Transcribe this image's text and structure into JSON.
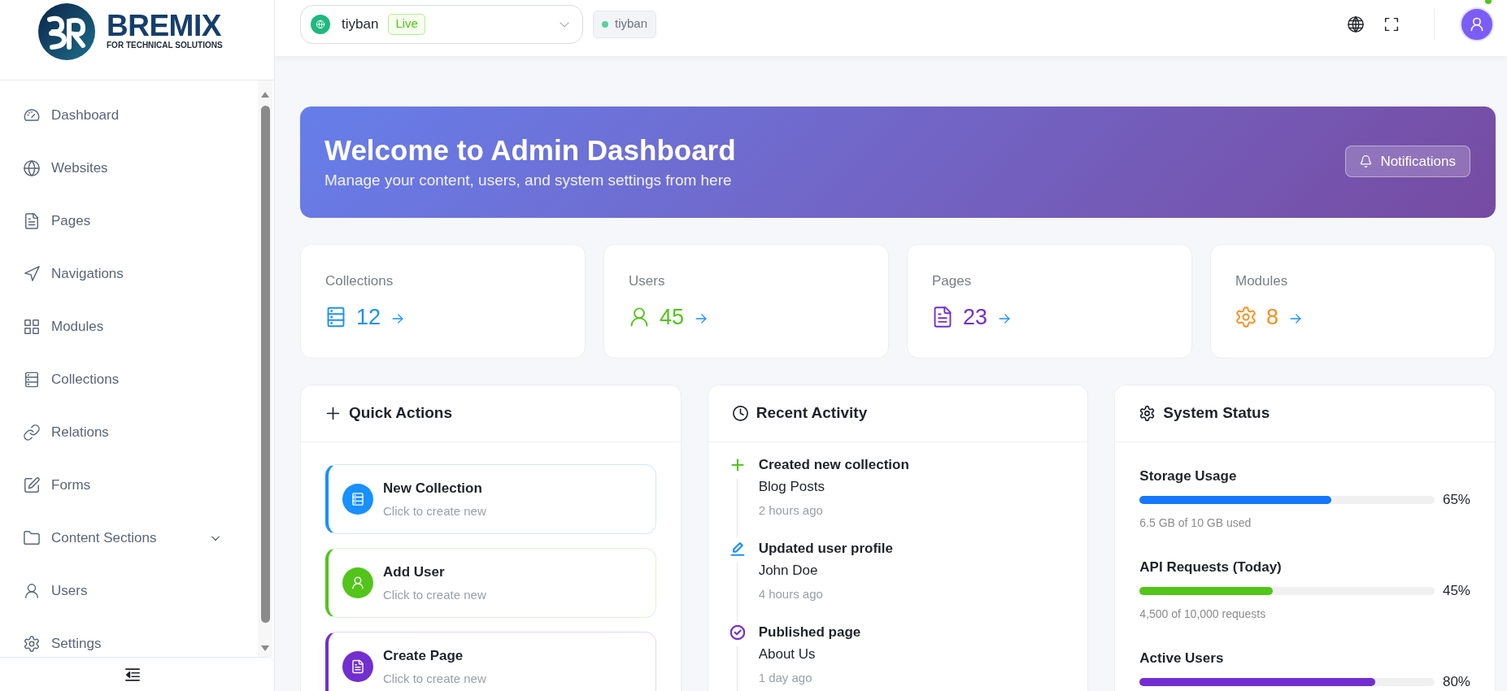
{
  "logo": {
    "name": "BREMIX",
    "tagline": "FOR TECHNICAL SOLUTIONS"
  },
  "sidebar": {
    "items": [
      {
        "kind": "link",
        "label": "Dashboard"
      },
      {
        "kind": "link",
        "label": "Websites"
      },
      {
        "kind": "link",
        "label": "Pages"
      },
      {
        "kind": "link",
        "label": "Navigations"
      },
      {
        "kind": "link",
        "label": "Modules"
      },
      {
        "kind": "link",
        "label": "Collections"
      },
      {
        "kind": "link",
        "label": "Relations"
      },
      {
        "kind": "link",
        "label": "Forms"
      },
      {
        "kind": "group",
        "label": "Content Sections",
        "expanded": false
      },
      {
        "kind": "link",
        "label": "Users"
      },
      {
        "kind": "link",
        "label": "Settings"
      }
    ]
  },
  "header": {
    "site_select": {
      "value": "tiyban",
      "badge": "Live"
    },
    "site_tag": {
      "label": "tiyban"
    }
  },
  "banner": {
    "title": "Welcome to Admin Dashboard",
    "subtitle": "Manage your content, users, and system settings from here",
    "button": "Notifications"
  },
  "stats": [
    {
      "label": "Collections",
      "value": "12",
      "color": "#1890ff"
    },
    {
      "label": "Users",
      "value": "45",
      "color": "#52c41a"
    },
    {
      "label": "Pages",
      "value": "23",
      "color": "#722ed1"
    },
    {
      "label": "Modules",
      "value": "8",
      "color": "#fa8c16"
    }
  ],
  "quick_actions": {
    "title": "Quick Actions",
    "items": [
      {
        "title": "New Collection",
        "subtitle": "Click to create new",
        "color": "#1890ff"
      },
      {
        "title": "Add User",
        "subtitle": "Click to create new",
        "color": "#52c41a"
      },
      {
        "title": "Create Page",
        "subtitle": "Click to create new",
        "color": "#722ed1"
      }
    ]
  },
  "recent_activity": {
    "title": "Recent Activity",
    "items": [
      {
        "kind": "create",
        "title": "Created new collection",
        "detail": "Blog Posts",
        "time": "2 hours ago",
        "color": "#52c41a"
      },
      {
        "kind": "update",
        "title": "Updated user profile",
        "detail": "John Doe",
        "time": "4 hours ago",
        "color": "#1890ff"
      },
      {
        "kind": "publish",
        "title": "Published page",
        "detail": "About Us",
        "time": "1 day ago",
        "color": "#722ed1"
      }
    ]
  },
  "system_status": {
    "title": "System Status",
    "items": [
      {
        "label": "Storage Usage",
        "level": 0.65,
        "reading": "65%",
        "detail": "6.5 GB of 10 GB used",
        "color": "#1677ff"
      },
      {
        "label": "API Requests (Today)",
        "level": 0.45,
        "reading": "45%",
        "detail": "4,500 of 10,000 requests",
        "color": "#52c41a"
      },
      {
        "label": "Active Users",
        "level": 0.8,
        "reading": "80%",
        "color": "#722ed1"
      }
    ]
  }
}
